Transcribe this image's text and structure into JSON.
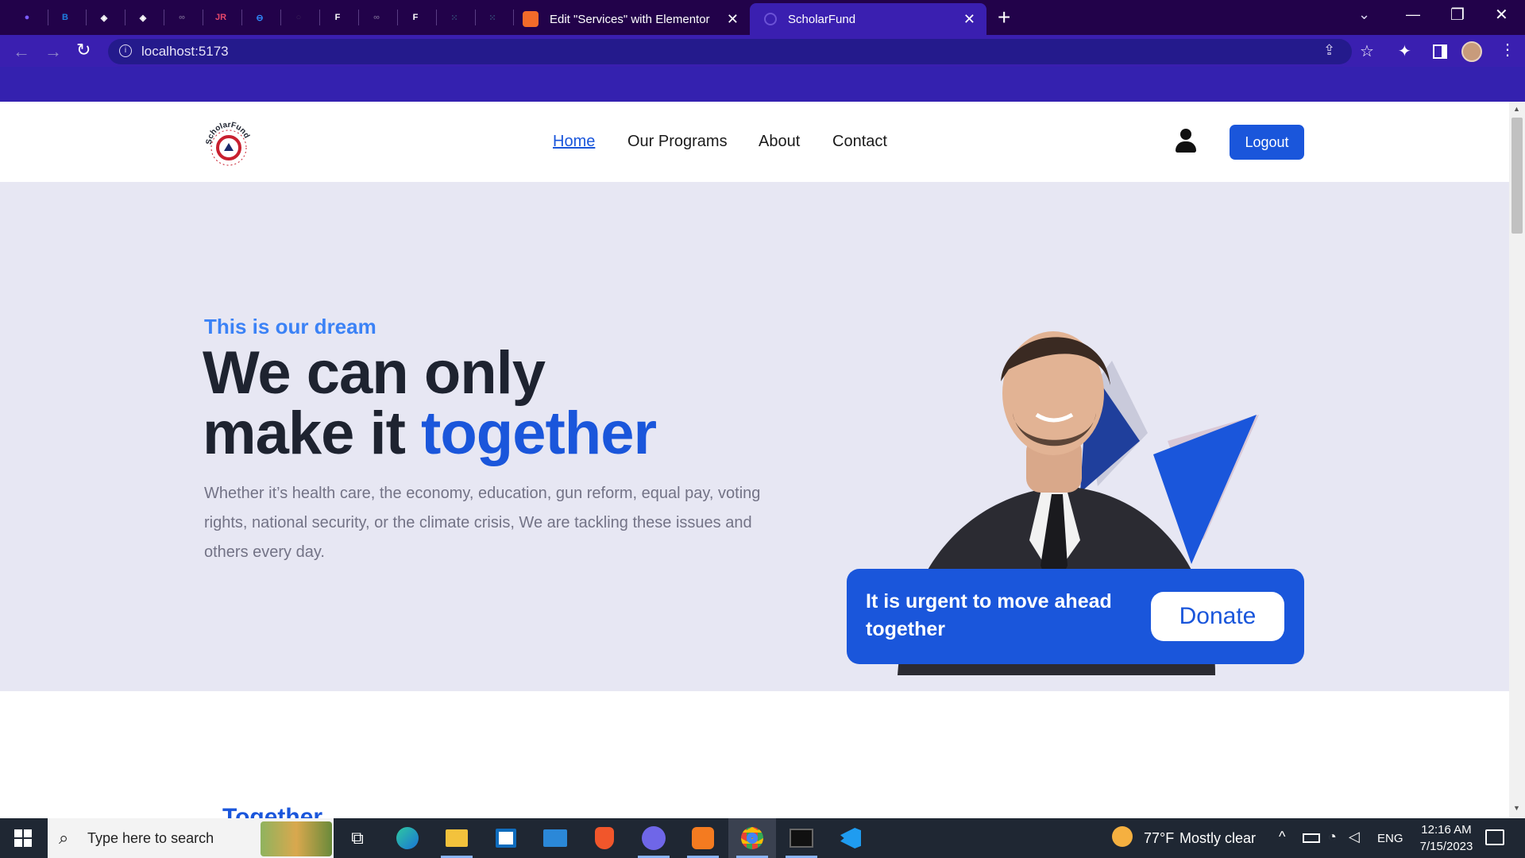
{
  "browser": {
    "pinned_tabs": [
      {
        "icon": "orb-icon",
        "glyph": "●",
        "color": "#7b5cff"
      },
      {
        "icon": "app-b-icon",
        "glyph": "B",
        "color": "#1f7ee0"
      },
      {
        "icon": "codepen-icon",
        "glyph": "◈",
        "color": "#ffffff"
      },
      {
        "icon": "codepen-icon",
        "glyph": "◈",
        "color": "#ffffff"
      },
      {
        "icon": "infinity-icon",
        "glyph": "∞",
        "color": "#6c5a88"
      },
      {
        "icon": "jr-icon",
        "glyph": "JR",
        "color": "#e8486b"
      },
      {
        "icon": "link-icon",
        "glyph": "⊖",
        "color": "#2f8bff"
      },
      {
        "icon": "blank-icon",
        "glyph": "○",
        "color": "#3b2456"
      },
      {
        "icon": "f-icon",
        "glyph": "F",
        "color": "#ffffff"
      },
      {
        "icon": "infinity-icon",
        "glyph": "∞",
        "color": "#6c5a88"
      },
      {
        "icon": "f-icon",
        "glyph": "F",
        "color": "#ffffff"
      },
      {
        "icon": "dots-icon",
        "glyph": "⁙",
        "color": "#35507a"
      },
      {
        "icon": "dots-icon",
        "glyph": "⁙",
        "color": "#35507a"
      }
    ],
    "tabs": [
      {
        "title": "Edit \"Services\" with Elementor",
        "active": false
      },
      {
        "title": "ScholarFund",
        "active": true
      }
    ],
    "url": "localhost:5173"
  },
  "site": {
    "logo_text": "ScholarFund",
    "nav": [
      "Home",
      "Our Programs",
      "About",
      "Contact"
    ],
    "logout_label": "Logout"
  },
  "hero": {
    "eyebrow": "This is our dream",
    "title_line1": "We can only",
    "title_line2_a": "make it ",
    "title_line2_b": "together",
    "paragraph": "Whether it’s health care, the economy, education, gun reform, equal pay, voting rights, national security, or the climate crisis, We are tackling these issues and others every day.",
    "cta_text": "It is urgent to move ahead together",
    "donate_label": "Donate"
  },
  "next_section_heading": "Together",
  "taskbar": {
    "search_placeholder": "Type here to search",
    "weather_temp": "77°F",
    "weather_text": "Mostly clear",
    "lang": "ENG",
    "time": "12:16 AM",
    "date": "7/15/2023"
  },
  "colors": {
    "brand_blue": "#1a56db",
    "accent_blue": "#3b82f6",
    "heading_dark": "#1e2330",
    "hero_bg": "#e7e7f3"
  }
}
